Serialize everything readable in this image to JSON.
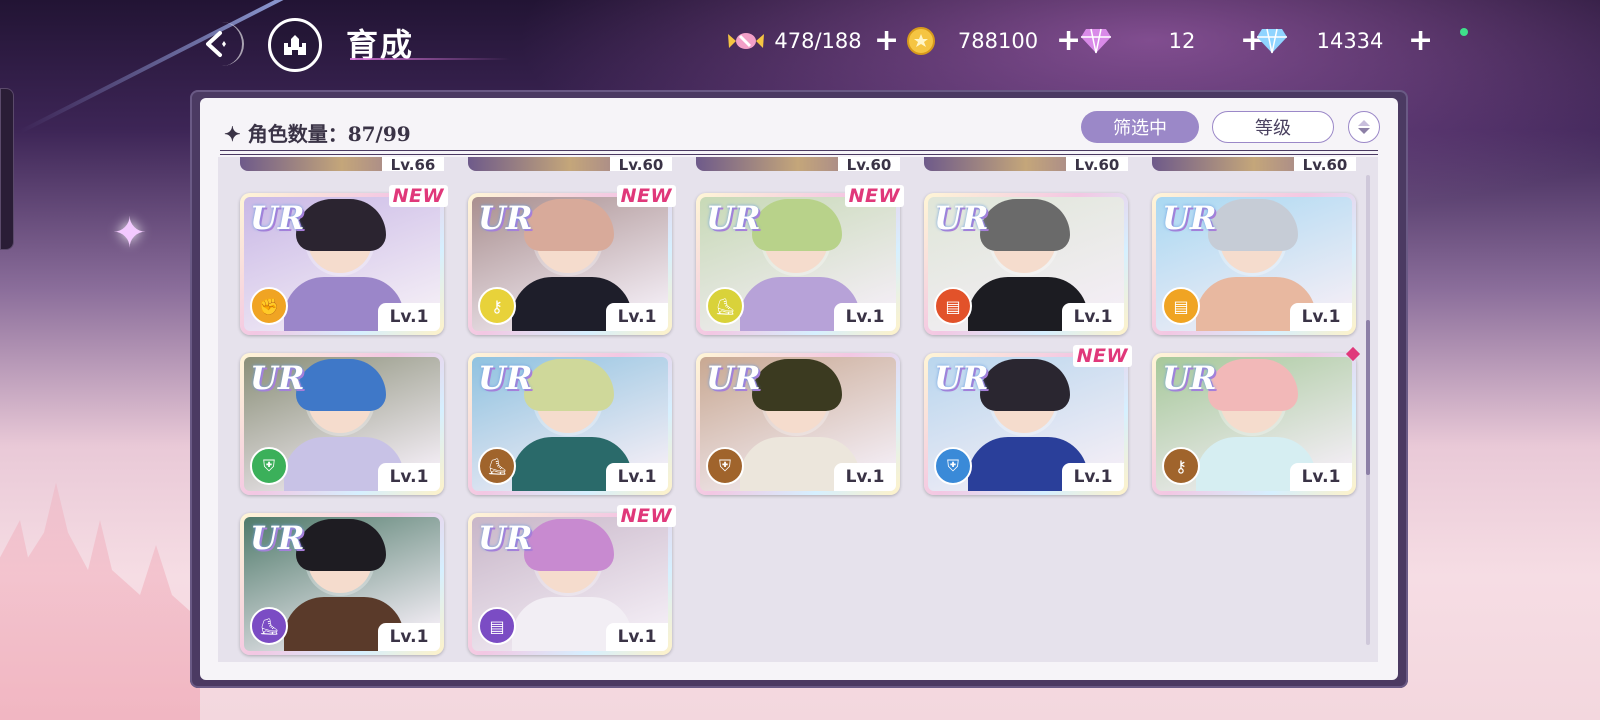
{
  "header": {
    "title": "育成",
    "resources": [
      {
        "name": "candy",
        "value": "478/188",
        "icon": "candy-icon",
        "color": "#f0a0d0"
      },
      {
        "name": "coin",
        "value": "788100",
        "icon": "coin-icon",
        "color": "#f5c542"
      },
      {
        "name": "pink-gem",
        "value": "12",
        "icon": "pink-gem-icon",
        "color": "#d98ae8"
      },
      {
        "name": "blue-gem",
        "value": "14334",
        "icon": "blue-gem-icon",
        "color": "#8fd4ff"
      }
    ],
    "plus": "+"
  },
  "panel": {
    "count_label": "✦ 角色数量：87/99",
    "filter_label": "筛选中",
    "sort_label": "等级"
  },
  "partial_row": [
    {
      "level": "Lv.66"
    },
    {
      "level": "Lv.60"
    },
    {
      "level": "Lv.60"
    },
    {
      "level": "Lv.60"
    },
    {
      "level": "Lv.60"
    }
  ],
  "cards": [
    {
      "rarity": "UR",
      "level": "Lv.1",
      "new": "NEW",
      "role_color": "#f0a423",
      "role_icon": "fist-icon",
      "hair": "#2b2430",
      "outfit": "#9b86c9",
      "bg": "#c9b8e6"
    },
    {
      "rarity": "UR",
      "level": "Lv.1",
      "new": "NEW",
      "role_color": "#e8d23a",
      "role_icon": "key-icon",
      "hair": "#d8aa9a",
      "outfit": "#1e1e2a",
      "bg": "#a98f8f"
    },
    {
      "rarity": "UR",
      "level": "Lv.1",
      "new": "NEW",
      "role_color": "#d9d23a",
      "role_icon": "boot-icon",
      "hair": "#b8d28a",
      "outfit": "#b7a2d8",
      "bg": "#c7d9b6"
    },
    {
      "rarity": "UR",
      "level": "Lv.1",
      "new": "",
      "role_color": "#e2522a",
      "role_icon": "book-icon",
      "hair": "#6a6a6a",
      "outfit": "#1c1c22",
      "bg": "#dfe6d8"
    },
    {
      "rarity": "UR",
      "level": "Lv.1",
      "new": "",
      "role_color": "#f0a423",
      "role_icon": "book-icon",
      "hair": "#c6ccd6",
      "outfit": "#e8b8a0",
      "bg": "#a9d8f2"
    },
    {
      "rarity": "UR",
      "level": "Lv.1",
      "new": "",
      "role_color": "#3bb05a",
      "role_icon": "shield-icon",
      "hair": "#3f78c8",
      "outfit": "#c8c2e6",
      "bg": "#8a8f78"
    },
    {
      "rarity": "UR",
      "level": "Lv.1",
      "new": "",
      "role_color": "#a0642c",
      "role_icon": "boot-icon",
      "hair": "#cfd89a",
      "outfit": "#2a6a6a",
      "bg": "#8fc2e0"
    },
    {
      "rarity": "UR",
      "level": "Lv.1",
      "new": "",
      "role_color": "#a0642c",
      "role_icon": "shield-icon",
      "hair": "#3b3a20",
      "outfit": "#ece6dc",
      "bg": "#c8a892"
    },
    {
      "rarity": "UR",
      "level": "Lv.1",
      "new": "NEW",
      "role_color": "#3a8ad8",
      "role_icon": "shield-icon",
      "hair": "#2a2630",
      "outfit": "#2a3f9a",
      "bg": "#b9d6ee"
    },
    {
      "rarity": "UR",
      "level": "Lv.1",
      "new": "",
      "role_color": "#a0642c",
      "role_icon": "key-icon",
      "hair": "#f2b8b8",
      "outfit": "#d6eef2",
      "bg": "#a6c89a",
      "pin": true
    },
    {
      "rarity": "UR",
      "level": "Lv.1",
      "new": "",
      "role_color": "#7b4cc4",
      "role_icon": "boot-icon",
      "hair": "#1e1c22",
      "outfit": "#5a3a2a",
      "bg": "#4f7a6a"
    },
    {
      "rarity": "UR",
      "level": "Lv.1",
      "new": "NEW",
      "role_color": "#7b4cc4",
      "role_icon": "book-icon",
      "hair": "#c88ad0",
      "outfit": "#f2eef4",
      "bg": "#c8b6c8"
    }
  ]
}
